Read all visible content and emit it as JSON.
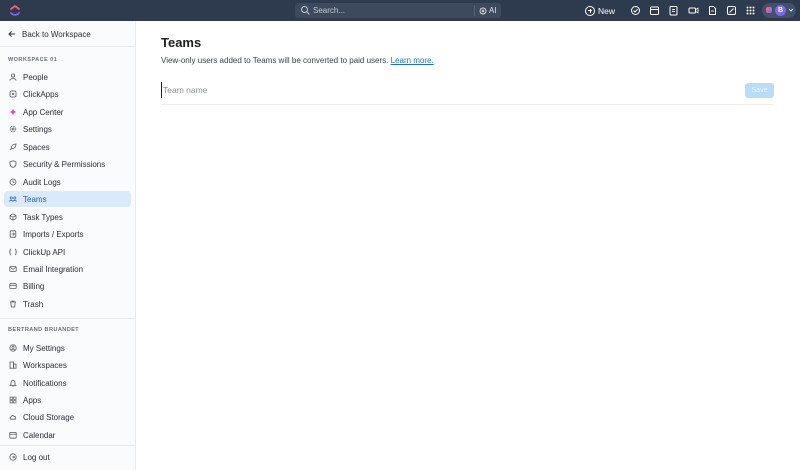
{
  "topbar": {
    "search_placeholder": "Search...",
    "ai_label": "AI",
    "new_label": "New",
    "avatar_initial": "B",
    "colors": {
      "background": "#2e3a4d",
      "search_bg": "#3d4a5e",
      "avatar": "#7b68ee"
    },
    "icons": [
      "check-circle-icon",
      "calendar-icon",
      "clipboard-icon",
      "video-icon",
      "document-icon",
      "edit-icon",
      "grid-icon"
    ]
  },
  "sidebar": {
    "back_label": "Back to Workspace",
    "workspace_title": "WORKSPACE 01",
    "workspace_items": [
      {
        "label": "People",
        "icon": "person-icon"
      },
      {
        "label": "ClickApps",
        "icon": "clickapps-icon"
      },
      {
        "label": "App Center",
        "icon": "app-center-icon"
      },
      {
        "label": "Settings",
        "icon": "gear-icon"
      },
      {
        "label": "Spaces",
        "icon": "rocket-icon"
      },
      {
        "label": "Security & Permissions",
        "icon": "shield-icon"
      },
      {
        "label": "Audit Logs",
        "icon": "clock-icon"
      },
      {
        "label": "Teams",
        "icon": "team-icon",
        "active": true
      },
      {
        "label": "Task Types",
        "icon": "cube-icon"
      },
      {
        "label": "Imports / Exports",
        "icon": "import-icon"
      },
      {
        "label": "ClickUp API",
        "icon": "api-icon"
      },
      {
        "label": "Email Integration",
        "icon": "mail-icon"
      },
      {
        "label": "Billing",
        "icon": "card-icon"
      },
      {
        "label": "Trash",
        "icon": "trash-icon"
      }
    ],
    "user_title": "BERTRAND BRUANDET",
    "user_items": [
      {
        "label": "My Settings",
        "icon": "user-circle-icon"
      },
      {
        "label": "Workspaces",
        "icon": "building-icon"
      },
      {
        "label": "Notifications",
        "icon": "bell-icon"
      },
      {
        "label": "Apps",
        "icon": "apps-icon"
      },
      {
        "label": "Cloud Storage",
        "icon": "cloud-icon"
      },
      {
        "label": "Calendar",
        "icon": "calendar-icon"
      }
    ],
    "logout_label": "Log out",
    "active_color": "#dbeafb"
  },
  "main": {
    "title": "Teams",
    "info_text": "View-only users added to Teams will be converted to paid users.",
    "learn_more": "Learn more.",
    "team_name_placeholder": "Team name",
    "save_label": "Save",
    "link_color": "#1a73c9"
  }
}
